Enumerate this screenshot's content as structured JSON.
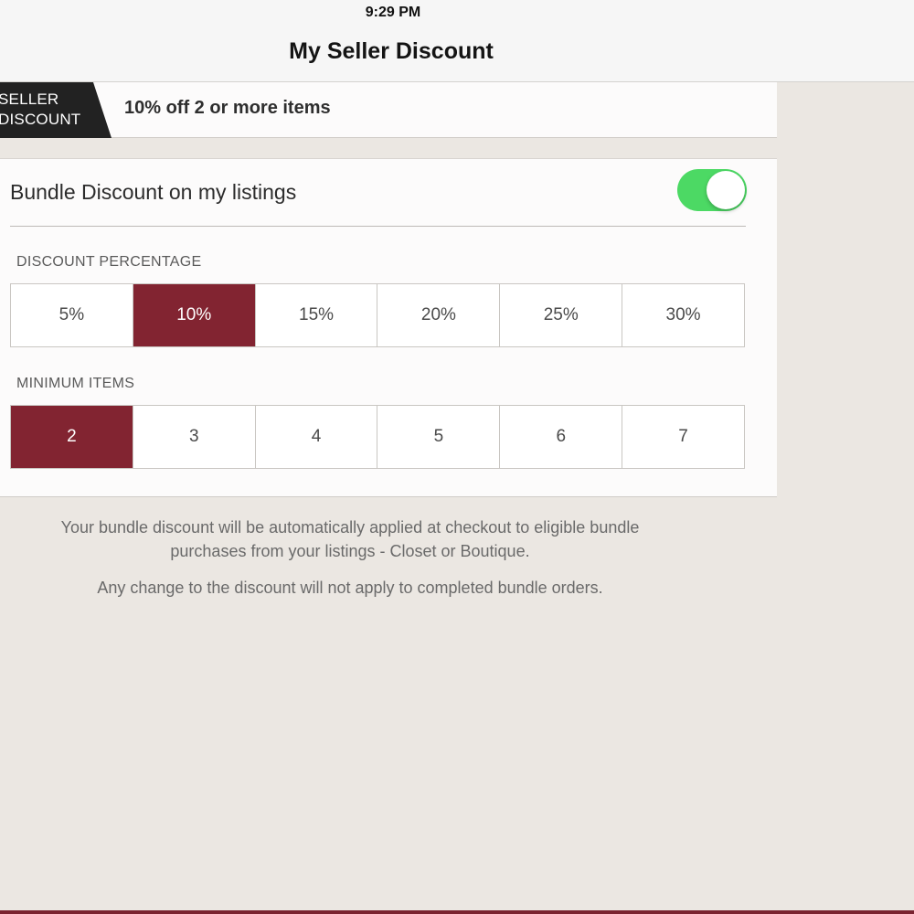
{
  "status_bar": {
    "time": "9:29 PM"
  },
  "nav": {
    "title": "My Seller Discount"
  },
  "summary": {
    "tag_line1": "SELLER",
    "tag_line2": "DISCOUNT",
    "text": "10% off 2 or more items"
  },
  "bundle": {
    "toggle_label": "Bundle Discount on my listings",
    "toggle_on": true,
    "toggle_color": "#4cd964"
  },
  "discount_percentage": {
    "label": "DISCOUNT PERCENTAGE",
    "options": [
      "5%",
      "10%",
      "15%",
      "20%",
      "25%",
      "30%"
    ],
    "selected": "10%"
  },
  "minimum_items": {
    "label": "MINIMUM ITEMS",
    "options": [
      "2",
      "3",
      "4",
      "5",
      "6",
      "7"
    ],
    "selected": "2"
  },
  "info": {
    "line1": "Your bundle discount will be automatically applied at checkout to eligible bundle",
    "line2": "purchases from your listings - Closet or Boutique.",
    "line3": "Any change to the discount will not apply to completed bundle orders."
  },
  "colors": {
    "accent": "#822431",
    "background": "#ebe7e2",
    "tag_background": "#222222"
  }
}
